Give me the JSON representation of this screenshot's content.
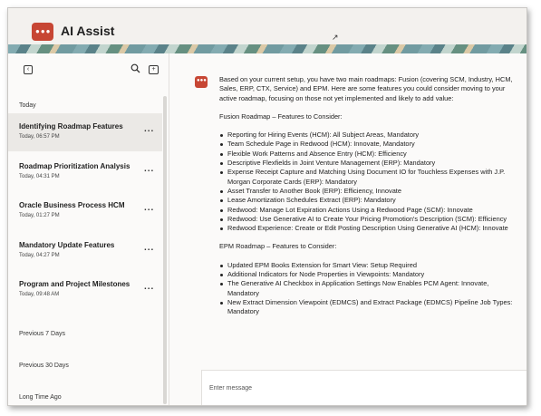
{
  "header": {
    "title": "AI Assist",
    "logo_icon": "chat-bubble-icon",
    "accent_color": "#c74634"
  },
  "sidebar": {
    "toolbar": {
      "collapse_icon": "sidebar-collapse-icon",
      "search_icon": "search-icon",
      "new_chat_icon": "new-chat-icon"
    },
    "sections": {
      "today": "Today",
      "previous_7": "Previous 7 Days",
      "previous_30": "Previous 30 Days",
      "long_time_ago": "Long Time Ago"
    },
    "conversations": [
      {
        "title": "Identifying Roadmap Features",
        "time": "Today, 06:57 PM"
      },
      {
        "title": "Roadmap Prioritization Analysis",
        "time": "Today, 04:31 PM"
      },
      {
        "title": "Oracle Business Process HCM",
        "time": "Today, 01:27 PM"
      },
      {
        "title": "Mandatory Update Features",
        "time": "Today, 04:27 PM"
      },
      {
        "title": "Program and Project Milestones",
        "time": "Today, 09:48 AM"
      }
    ],
    "more_label": "..."
  },
  "main": {
    "intro": "Based on your current setup, you have two main roadmaps: Fusion (covering SCM, Industry, HCM, Sales, ERP, CTX, Service) and EPM. Here are some features you could consider moving to your active roadmap, focusing on those not yet implemented and likely to add value:",
    "fusion_heading": "Fusion Roadmap – Features to Consider:",
    "fusion_items": [
      "Reporting for Hiring Events (HCM): All Subject Areas, Mandatory",
      "Team Schedule Page in Redwood (HCM): Innovate, Mandatory",
      "Flexible Work Patterns and Absence Entry (HCM): Efficiency",
      "Descriptive Flexfields in Joint Venture Management (ERP): Mandatory",
      "Expense Receipt Capture and Matching Using Document IO for Touchless Expenses with J.P. Morgan Corporate Cards (ERP): Mandatory",
      "Asset Transfer to Another Book (ERP): Efficiency, Innovate",
      "Lease Amortization Schedules Extract (ERP): Mandatory",
      "Redwood: Manage Lot Expiration Actions Using a Redwood Page (SCM): Innovate",
      "Redwood: Use Generative AI to Create Your Pricing Promotion's Description (SCM): Efficiency",
      "Redwood Experience: Create or Edit Posting Description Using Generative AI (HCM): Innovate"
    ],
    "epm_heading": "EPM Roadmap – Features to Consider:",
    "epm_items": [
      "Updated EPM Books Extension for Smart View: Setup Required",
      "Additional Indicators for Node Properties in Viewpoints: Mandatory",
      "The Generative AI Checkbox in Application Settings Now Enables PCM Agent: Innovate, Mandatory",
      "New Extract Dimension Viewpoint (EDMCS) and Extract Package (EDMCS) Pipeline Job Types: Mandatory"
    ],
    "composer": {
      "placeholder": "Enter message"
    }
  }
}
